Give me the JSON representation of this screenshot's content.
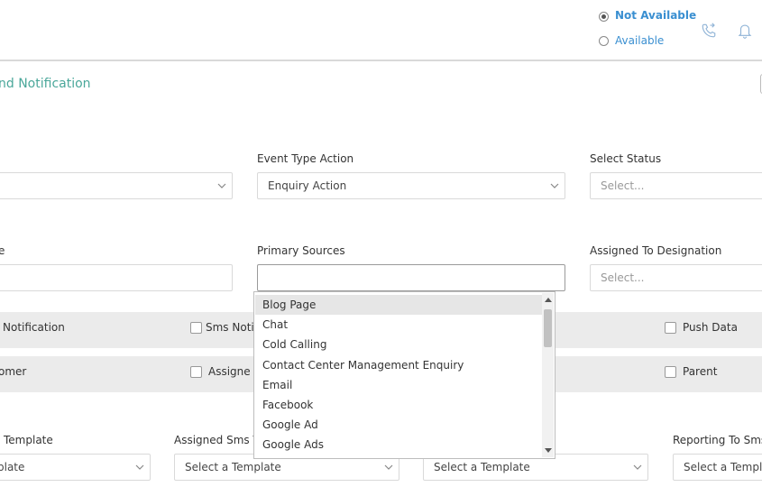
{
  "header": {
    "status_options": [
      {
        "label": "Not Available",
        "selected": true
      },
      {
        "label": "Available",
        "selected": false
      }
    ],
    "icons": [
      "phone-icon",
      "bell-icon"
    ]
  },
  "page": {
    "title_fragment": "nd Notification"
  },
  "row1": {
    "field_a": {
      "label": "",
      "value": ""
    },
    "event_type_action": {
      "label": "Event Type Action",
      "value": "Enquiry Action"
    },
    "select_status": {
      "label": "Select Status",
      "placeholder": "Select..."
    }
  },
  "row2": {
    "field_a": {
      "label": "e",
      "value": ""
    },
    "primary_sources": {
      "label": "Primary Sources",
      "value": ""
    },
    "assigned_designation": {
      "label": "Assigned To Designation",
      "placeholder": "Select..."
    }
  },
  "checks_row1": {
    "c1": "Notification",
    "c2": "Sms Noti",
    "c3": "Push Data"
  },
  "checks_row2": {
    "c1": "omer",
    "c2": "Assigne",
    "c3": "Parent"
  },
  "templates": {
    "t1": {
      "label": "Template",
      "value": "plate"
    },
    "t2": {
      "label": "Assigned Sms T",
      "value": "Select a Template"
    },
    "t3": {
      "label": "",
      "value": "Select a Template"
    },
    "t4": {
      "label": "Reporting To Sms",
      "value": "Select a Templa"
    }
  },
  "dropdown": {
    "items": [
      "Blog Page",
      "Chat",
      "Cold Calling",
      "Contact Center Management Enquiry",
      "Email",
      "Facebook",
      "Google Ad",
      "Google Ads"
    ],
    "highlighted_index": 0
  },
  "colors": {
    "accent_blue": "#3a8fd1",
    "title_teal": "#4aa79a",
    "band_gray": "#ebebeb"
  }
}
